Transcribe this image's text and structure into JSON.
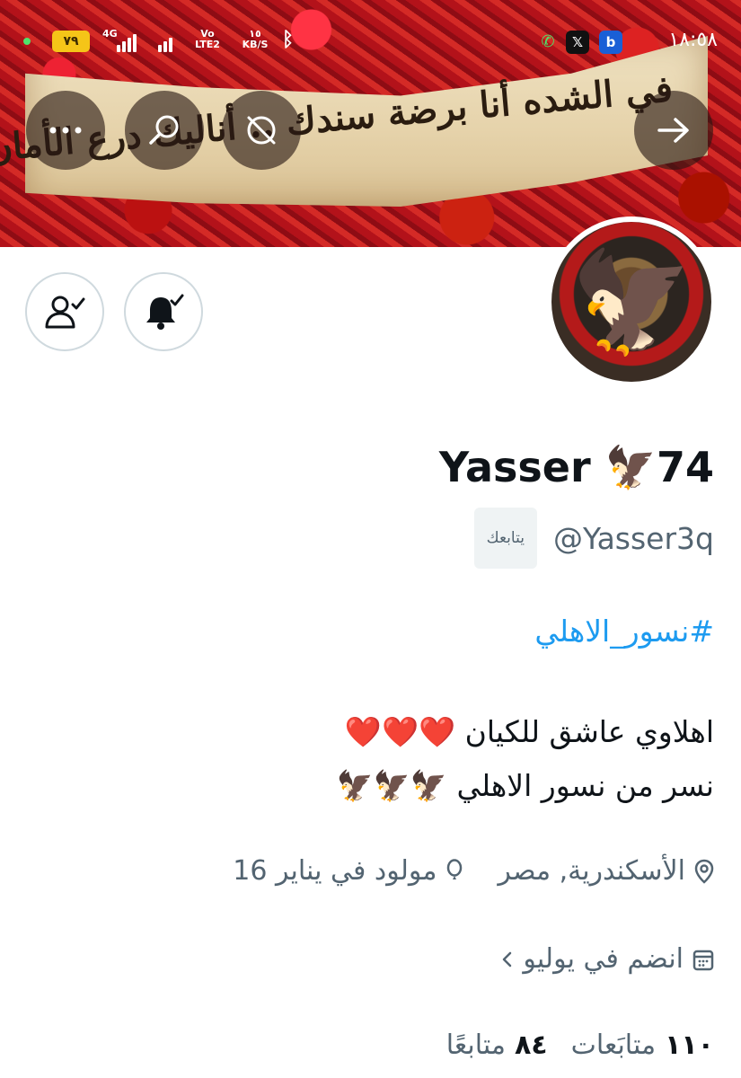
{
  "status_bar": {
    "battery": "٧٩",
    "network": "4G",
    "volte": "Vo LTE2",
    "speed_value": "١٥",
    "speed_unit": "KB/S",
    "time": "١٨:٥٨",
    "notification_apps": [
      "x-icon",
      "b-app-icon",
      "whatsapp-icon"
    ]
  },
  "header_banner": {
    "slogan": "في الشده أنا برضة سندك .. أناليك درع الأمان",
    "colors": {
      "crowd": "#b3121a",
      "cloth": "#e6d3ab"
    }
  },
  "header_actions": {
    "back_icon": "arrow-right-icon",
    "mute_icon": "mute-icon",
    "search_icon": "search-icon",
    "more_icon": "more-icon"
  },
  "profile_actions": {
    "notification_icon": "bell-check-icon",
    "following_icon": "person-check-icon"
  },
  "profile": {
    "display_name": "Yasser 🦅74",
    "handle": "@Yasser3q",
    "follows_you": "يتابعك",
    "hashtag": "#نسور_الاهلي",
    "bio_lines": [
      "اهلاوي عاشق للكيان ❤️❤️❤️",
      "نسر من نسور الاهلي 🦅🦅🦅"
    ],
    "location": "الأسكندرية, مصر",
    "birthday": "مولود في يناير 16",
    "joined": "انضم في يوليو",
    "following_count": "١١٠",
    "following_label": "متابَعات",
    "followers_count": "٨٤",
    "followers_label": "متابعًا"
  },
  "colors": {
    "accent": "#1d9bf0",
    "secondary_text": "#536471",
    "primary_text": "#0f1419"
  }
}
